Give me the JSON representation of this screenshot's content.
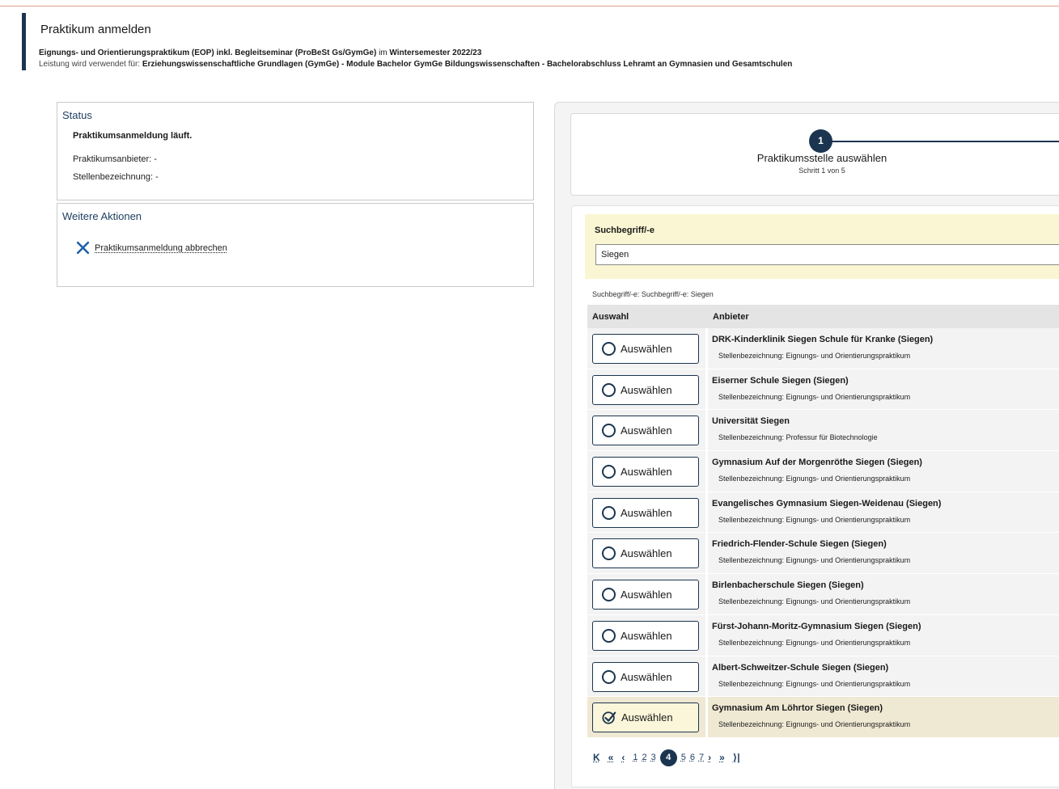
{
  "header": {
    "title": "Praktikum anmelden",
    "line1_bold1": "Eignungs- und Orientierungspraktikum (EOP) inkl. Begleitseminar (ProBeSt Gs/GymGe)",
    "line1_mid": " im ",
    "line1_bold2": "Wintersemester 2022/23",
    "line2_prefix": "Leistung wird verwendet für: ",
    "line2_bold": "Erziehungswissenschaftliche Grundlagen (GymGe) - Module Bachelor GymGe Bildungswissenschaften - Bachelorabschluss Lehramt an Gymnasien und Gesamtschulen"
  },
  "status": {
    "title": "Status",
    "state": "Praktikumsanmeldung läuft.",
    "anbieter": "Praktikumsanbieter: -",
    "stelle": "Stellenbezeichnung: -"
  },
  "actions": {
    "title": "Weitere Aktionen",
    "cancel_label": "Praktikumsanmeldung abbrechen",
    "cancel_icon": "close-icon"
  },
  "wizard": {
    "step_number": "1",
    "step_title": "Praktikumsstelle auswählen",
    "step_sub": "Schritt 1 von 5"
  },
  "search": {
    "label": "Suchbegriff/-e",
    "value": "Siegen",
    "filter_info": "Suchbegriff/-e: Suchbegriff/-e: Siegen"
  },
  "table": {
    "col_select": "Auswahl",
    "col_provider": "Anbieter",
    "select_label": "Auswählen",
    "rows": [
      {
        "name": "DRK-Kinderklinik Siegen Schule für Kranke (Siegen)",
        "position": "Stellenbezeichnung: Eignungs- und Orientierungspraktikum",
        "selected": false
      },
      {
        "name": "Eiserner Schule Siegen (Siegen)",
        "position": "Stellenbezeichnung: Eignungs- und Orientierungspraktikum",
        "selected": false
      },
      {
        "name": "Universität Siegen",
        "position": "Stellenbezeichnung: Professur für Biotechnologie",
        "selected": false
      },
      {
        "name": "Gymnasium Auf der Morgenröthe Siegen (Siegen)",
        "position": "Stellenbezeichnung: Eignungs- und Orientierungspraktikum",
        "selected": false
      },
      {
        "name": "Evangelisches Gymnasium Siegen-Weidenau (Siegen)",
        "position": "Stellenbezeichnung: Eignungs- und Orientierungspraktikum",
        "selected": false
      },
      {
        "name": "Friedrich-Flender-Schule Siegen (Siegen)",
        "position": "Stellenbezeichnung: Eignungs- und Orientierungspraktikum",
        "selected": false
      },
      {
        "name": "Birlenbacherschule Siegen (Siegen)",
        "position": "Stellenbezeichnung: Eignungs- und Orientierungspraktikum",
        "selected": false
      },
      {
        "name": "Fürst-Johann-Moritz-Gymnasium Siegen (Siegen)",
        "position": "Stellenbezeichnung: Eignungs- und Orientierungspraktikum",
        "selected": false
      },
      {
        "name": "Albert-Schweitzer-Schule Siegen (Siegen)",
        "position": "Stellenbezeichnung: Eignungs- und Orientierungspraktikum",
        "selected": false
      },
      {
        "name": "Gymnasium Am Löhrtor Siegen (Siegen)",
        "position": "Stellenbezeichnung: Eignungs- und Orientierungspraktikum",
        "selected": true
      }
    ]
  },
  "pager": {
    "first": "K",
    "prev_fast": "«",
    "prev": "‹",
    "pages": [
      "1",
      "2",
      "3",
      "4",
      "5",
      "6",
      "7"
    ],
    "current": "4",
    "next": "›",
    "next_fast": "»",
    "last": "⟩|"
  },
  "colors": {
    "accent": "#1b3550",
    "search_bg": "#faf6d3",
    "selected_row_bg": "#efe8d3"
  }
}
